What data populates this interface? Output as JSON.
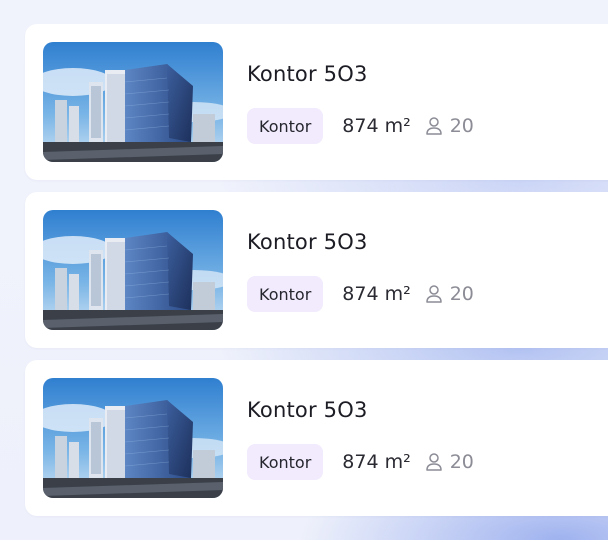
{
  "listings": [
    {
      "title": "Kontor 5O3",
      "type_tag": "Kontor",
      "area": "874 m²",
      "capacity": "20",
      "person_icon": "person-icon"
    },
    {
      "title": "Kontor 5O3",
      "type_tag": "Kontor",
      "area": "874 m²",
      "capacity": "20",
      "person_icon": "person-icon"
    },
    {
      "title": "Kontor 5O3",
      "type_tag": "Kontor",
      "area": "874 m²",
      "capacity": "20",
      "person_icon": "person-icon"
    }
  ],
  "colors": {
    "tag_background": "#f1ebfd",
    "card_background": "#ffffff",
    "page_background": "#eef1fb",
    "muted_text": "#8c8c96"
  }
}
